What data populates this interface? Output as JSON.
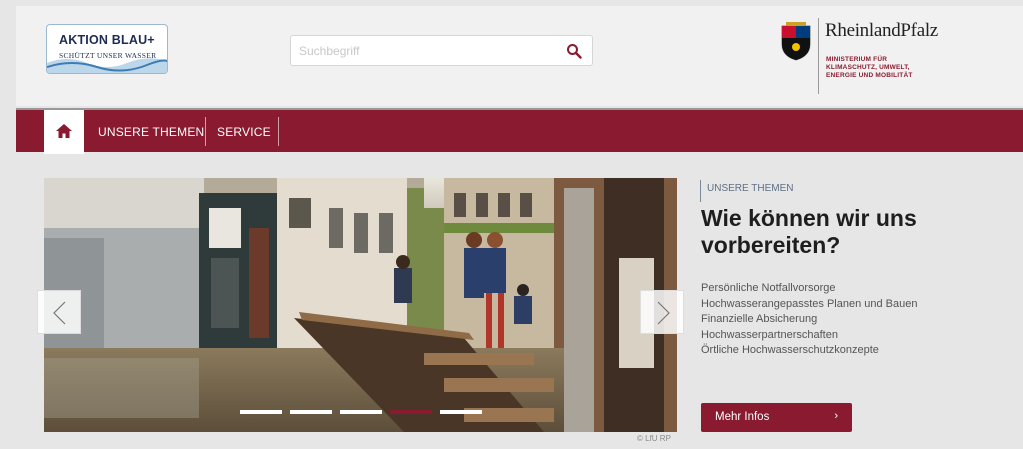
{
  "header": {
    "logo_aktion": {
      "title": "AKTION BLAU+",
      "subtitle": "SCHÜTZT UNSER WASSER"
    },
    "search": {
      "placeholder": "Suchbegriff",
      "icon": "search-icon"
    },
    "rlp_logo": {
      "name": "RheinlandPfalz",
      "ministry_lines": [
        "MINISTERIUM FÜR",
        "KLIMASCHUTZ, UMWELT,",
        "ENERGIE UND MOBILITÄT"
      ]
    }
  },
  "nav": {
    "home_icon": "home-icon",
    "items": [
      {
        "label": "UNSERE THEMEN"
      },
      {
        "label": "SERVICE"
      }
    ]
  },
  "slider": {
    "prev_icon": "chevron-left-icon",
    "next_icon": "chevron-right-icon",
    "slide_count": 5,
    "active_slide_index": 3,
    "credit": "© LfU RP"
  },
  "teaser": {
    "kicker": "UNSERE THEMEN",
    "headline": "Wie können wir uns vorbereiten?",
    "links": [
      "Persönliche Notfallvorsorge",
      "Hochwasserangepasstes Planen und Bauen",
      "Finanzielle Absicherung",
      "Hochwasserpartnerschaften",
      "Örtliche Hochwasserschutzkonzepte"
    ],
    "button_label": "Mehr Infos",
    "button_icon": "chevron-right-icon"
  },
  "colors": {
    "brand": "#8a1a2f",
    "header_bg": "#f1f1f1",
    "page_bg": "#e6e6e6",
    "kicker": "#5e6f85"
  }
}
